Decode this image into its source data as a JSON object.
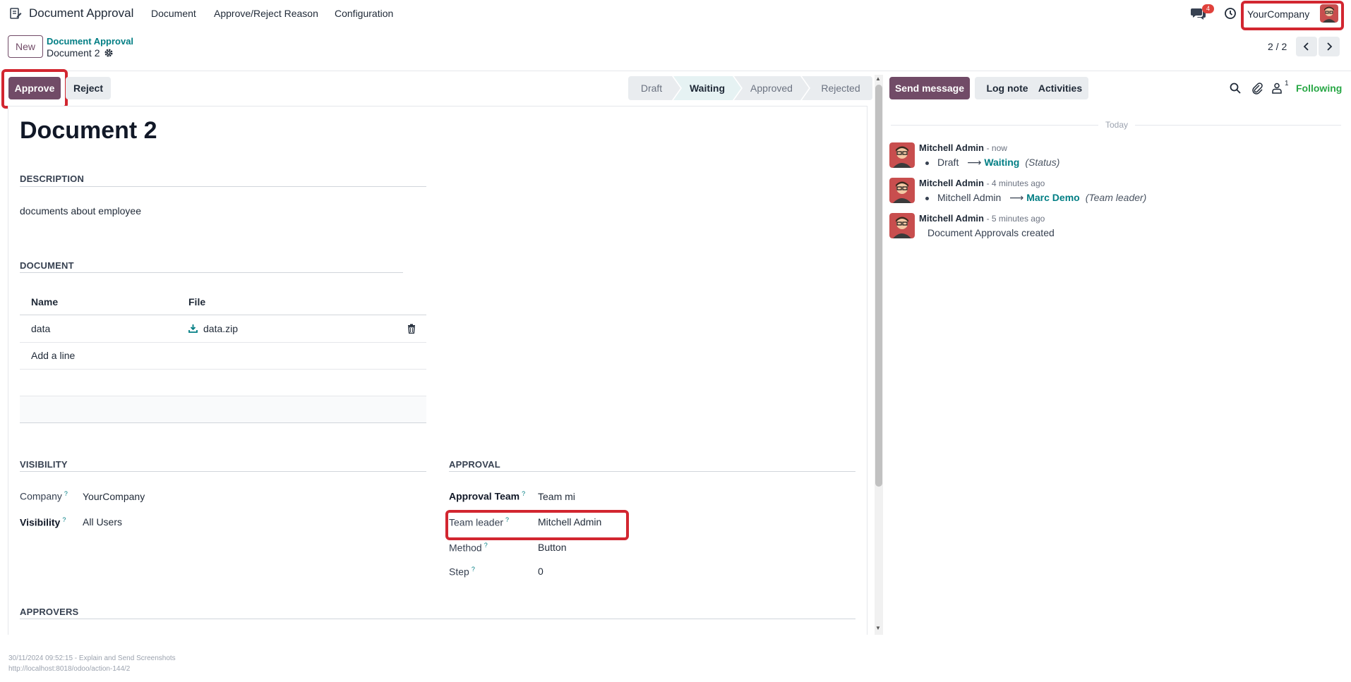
{
  "topnav": {
    "app_name": "Document Approval",
    "menu": [
      "Document",
      "Approve/Reject Reason",
      "Configuration"
    ],
    "chat_badge": "4",
    "company": "YourCompany"
  },
  "control": {
    "new_label": "New",
    "breadcrumb_parent": "Document Approval",
    "breadcrumb_current": "Document 2",
    "pager": "2 / 2"
  },
  "actions": {
    "approve": "Approve",
    "reject": "Reject"
  },
  "stages": [
    {
      "label": "Draft",
      "active": false
    },
    {
      "label": "Waiting",
      "active": true
    },
    {
      "label": "Approved",
      "active": false
    },
    {
      "label": "Rejected",
      "active": false
    }
  ],
  "form": {
    "title": "Document 2",
    "description_title": "DESCRIPTION",
    "description": "documents about employee",
    "document_title": "DOCUMENT",
    "table_headers": [
      "Name",
      "File"
    ],
    "rows": [
      {
        "name": "data",
        "file": "data.zip"
      }
    ],
    "add_line": "Add a line",
    "visibility_title": "VISIBILITY",
    "company_label": "Company",
    "company_value": "YourCompany",
    "visibility_label": "Visibility",
    "visibility_value": "All Users",
    "approval_title": "APPROVAL",
    "approval_team_label": "Approval Team",
    "approval_team_value": "Team mi",
    "team_leader_label": "Team leader",
    "team_leader_value": "Mitchell Admin",
    "method_label": "Method",
    "method_value": "Button",
    "step_label": "Step",
    "step_value": "0",
    "approvers_title": "APPROVERS",
    "help_mark": "?"
  },
  "chatter": {
    "send_message": "Send message",
    "log_note": "Log note",
    "activities": "Activities",
    "follower_count": "1",
    "following": "Following",
    "today": "Today",
    "messages": [
      {
        "author": "Mitchell Admin",
        "time": "- now",
        "old": "Draft",
        "new": "Waiting",
        "field": "(Status)"
      },
      {
        "author": "Mitchell Admin",
        "time": "- 4 minutes ago",
        "old": "Mitchell Admin",
        "new": "Marc Demo",
        "field": "(Team leader)"
      },
      {
        "author": "Mitchell Admin",
        "time": "- 5 minutes ago",
        "text": "Document Approvals created"
      }
    ],
    "arrow": "⟶"
  },
  "footer": {
    "line1": "30/11/2024 09:52:15 - Explain and Send Screenshots",
    "line2": "http://localhost:8018/odoo/action-144/2"
  },
  "colors": {
    "primary": "#714b67",
    "link": "#017e84",
    "highlight": "#d22630",
    "following": "#28a745"
  }
}
